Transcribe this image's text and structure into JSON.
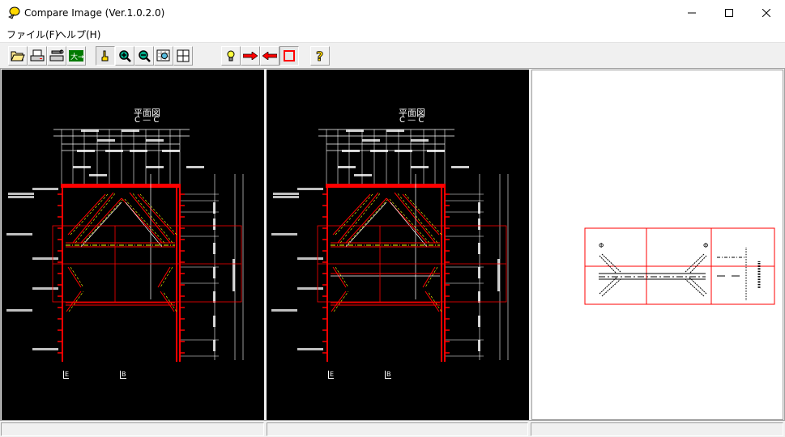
{
  "window": {
    "title": "Compare Image (Ver.1.0.2.0)",
    "minimize_icon": "minimize-icon",
    "maximize_icon": "maximize-icon",
    "close_icon": "close-icon"
  },
  "menu": [
    {
      "label": "ファイル(F)"
    },
    {
      "label": "ヘルプ(H)"
    }
  ],
  "toolbar": [
    {
      "name": "open-button",
      "icon": "folder-open-icon"
    },
    {
      "name": "print-button",
      "icon": "printer-icon"
    },
    {
      "name": "print-setup-button",
      "icon": "printer-setup-icon"
    },
    {
      "name": "exit-button",
      "icon": "exit-icon"
    },
    {
      "name": "pan-button",
      "icon": "hand-icon",
      "pressed": true
    },
    {
      "name": "zoom-in-button",
      "icon": "zoom-in-icon"
    },
    {
      "name": "zoom-out-button",
      "icon": "zoom-out-icon"
    },
    {
      "name": "zoom-window-button",
      "icon": "zoom-window-icon"
    },
    {
      "name": "fit-button",
      "icon": "fit-all-icon"
    },
    {
      "name": "highlight-button",
      "icon": "lightbulb-icon"
    },
    {
      "name": "next-diff-button",
      "icon": "arrow-right-icon"
    },
    {
      "name": "prev-diff-button",
      "icon": "arrow-left-icon"
    },
    {
      "name": "diff-frame-button",
      "icon": "red-square-icon"
    },
    {
      "name": "help-button",
      "icon": "help-icon"
    }
  ],
  "drawing": {
    "title": "平面図",
    "section": "C — C",
    "label_e": "E",
    "label_b": "B"
  },
  "status": {
    "left": "",
    "middle": "",
    "right": ""
  },
  "colors": {
    "accent_red": "#ff0000",
    "cad_bg": "#000000",
    "cad_line": "#ffffff",
    "cad_yellow": "#ffff00"
  }
}
